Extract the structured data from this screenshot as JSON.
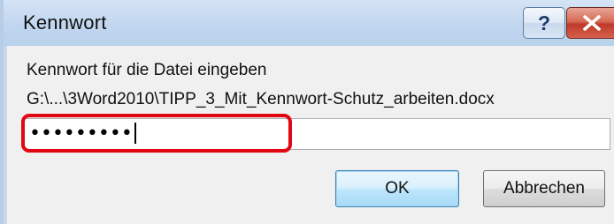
{
  "window": {
    "title": "Kennwort",
    "help_glyph": "?",
    "help_icon": "help-icon",
    "close_icon": "close-icon"
  },
  "form": {
    "prompt": "Kennwort für die Datei eingeben",
    "file_path": "G:\\...\\3Word2010\\TIPP_3_Mit_Kennwort-Schutz_arbeiten.docx",
    "password_masked": "•••••••••"
  },
  "buttons": {
    "ok_label": "OK",
    "cancel_label": "Abbrechen"
  },
  "colors": {
    "annotation_highlight": "#e30613",
    "title_bar": "#c1d6ef",
    "close_button": "#c0392b"
  }
}
